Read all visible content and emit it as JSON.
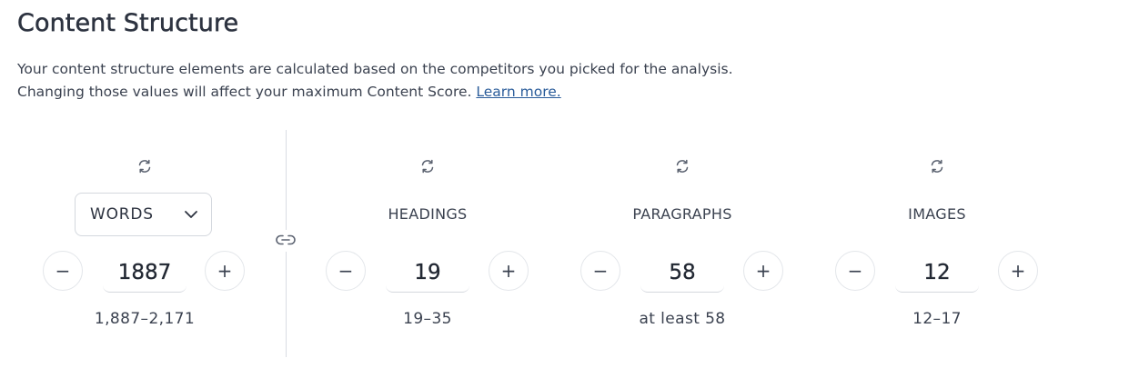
{
  "header": {
    "title": "Content Structure",
    "description_line1": "Your content structure elements are calculated based on the competitors you picked for the analysis.",
    "description_line2": "Changing those values will affect your maximum Content Score.",
    "learn_more": "Learn more."
  },
  "metrics": {
    "words": {
      "selector_value": "WORDS",
      "value": "1887",
      "range": "1,887–2,171",
      "minus": "−",
      "plus": "+"
    },
    "headings": {
      "label": "HEADINGS",
      "value": "19",
      "range": "19–35",
      "minus": "−",
      "plus": "+"
    },
    "paragraphs": {
      "label": "PARAGRAPHS",
      "value": "58",
      "range": "at least 58",
      "minus": "−",
      "plus": "+"
    },
    "images": {
      "label": "IMAGES",
      "value": "12",
      "range": "12–17",
      "minus": "−",
      "plus": "+"
    }
  },
  "icons": {
    "refresh": "refresh-icon",
    "link": "link-icon",
    "chevron": "chevron-down-icon"
  },
  "colors": {
    "text": "#2d3340",
    "link": "#2a5c9a",
    "border": "#d4d8de"
  }
}
